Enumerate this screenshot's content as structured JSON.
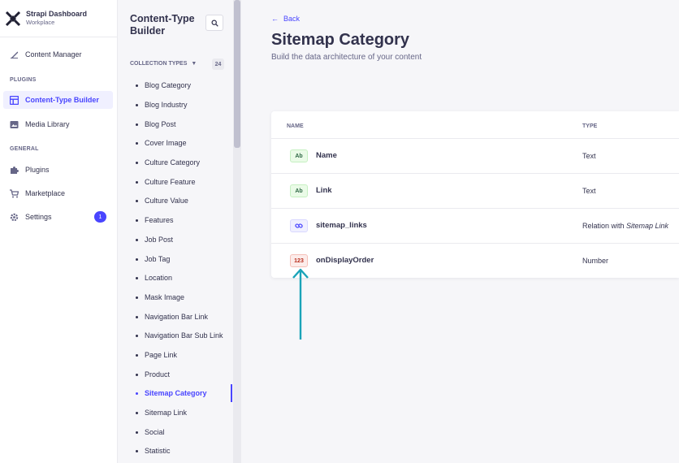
{
  "brand": {
    "title": "Strapi Dashboard",
    "subtitle": "Workplace"
  },
  "leftnav": {
    "content_manager": "Content Manager",
    "plugins_section": "PLUGINS",
    "ctb": "Content-Type Builder",
    "media_library": "Media Library",
    "general_section": "GENERAL",
    "plugins": "Plugins",
    "marketplace": "Marketplace",
    "settings": "Settings",
    "settings_badge": "1"
  },
  "subnav": {
    "title": "Content-Type Builder",
    "collection_header": "COLLECTION TYPES",
    "collection_count": "24",
    "items": [
      "Blog Category",
      "Blog Industry",
      "Blog Post",
      "Cover Image",
      "Culture Category",
      "Culture Feature",
      "Culture Value",
      "Features",
      "Job Post",
      "Job Tag",
      "Location",
      "Mask Image",
      "Navigation Bar Link",
      "Navigation Bar Sub Link",
      "Page Link",
      "Product",
      "Sitemap Category",
      "Sitemap Link",
      "Social",
      "Statistic"
    ],
    "active_item": "Sitemap Category"
  },
  "main": {
    "back": "Back",
    "title": "Sitemap Category",
    "subtitle": "Build the data architecture of your content",
    "table": {
      "col_name": "NAME",
      "col_type": "TYPE",
      "rows": [
        {
          "icon": "Ab",
          "name": "Name",
          "type": "Text"
        },
        {
          "icon": "Ab",
          "name": "Link",
          "type": "Text"
        },
        {
          "icon": "relation-icon",
          "name": "sitemap_links",
          "type_prefix": "Relation with ",
          "type_target": "Sitemap Link"
        },
        {
          "icon": "123",
          "name": "onDisplayOrder",
          "type": "Number"
        }
      ]
    }
  },
  "colors": {
    "accent": "#4945ff",
    "annotation": "#1aa3b8"
  }
}
